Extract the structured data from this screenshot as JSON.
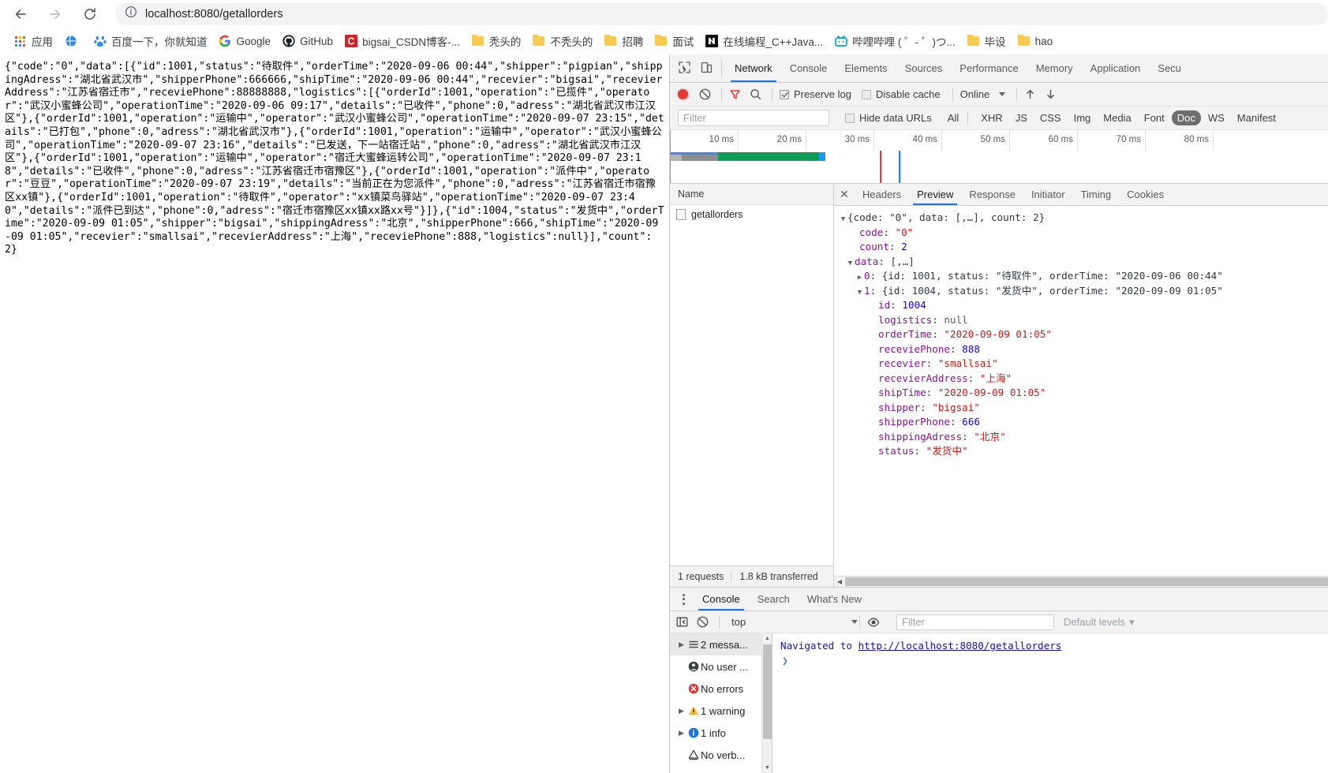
{
  "browser": {
    "back_icon": "back-arrow-icon",
    "forward_icon": "forward-arrow-icon",
    "reload_icon": "reload-icon",
    "site_info_icon": "site-info-icon",
    "url": "localhost:8080/getallorders",
    "url_host": "localhost:8080",
    "url_path": "/getallorders"
  },
  "bookmarks": [
    {
      "label": "应用",
      "icon": "apps-grid-icon"
    },
    {
      "label": "",
      "icon": "globe-icon"
    },
    {
      "label": "百度一下，你就知道",
      "icon": "baidu-icon"
    },
    {
      "label": "Google",
      "icon": "google-icon"
    },
    {
      "label": "GitHub",
      "icon": "github-icon"
    },
    {
      "label": "bigsai_CSDN博客-...",
      "icon": "csdn-icon"
    },
    {
      "label": "秃头的",
      "icon": "folder-icon"
    },
    {
      "label": "不秃头的",
      "icon": "folder-icon"
    },
    {
      "label": "招聘",
      "icon": "folder-icon"
    },
    {
      "label": "面试",
      "icon": "folder-icon"
    },
    {
      "label": "在线编程_C++Java...",
      "icon": "nowcoder-icon"
    },
    {
      "label": "哔哩哔哩 ( ゜- ゜)つ...",
      "icon": "bilibili-icon"
    },
    {
      "label": "毕设",
      "icon": "folder-icon"
    },
    {
      "label": "hao",
      "icon": "folder-icon"
    }
  ],
  "page": {
    "json_text": "{\"code\":\"0\",\"data\":[{\"id\":1001,\"status\":\"待取件\",\"orderTime\":\"2020-09-06 00:44\",\"shipper\":\"pigpian\",\"shippingAdress\":\"湖北省武汉市\",\"shipperPhone\":666666,\"shipTime\":\"2020-09-06 00:44\",\"recevier\":\"bigsai\",\"recevierAddress\":\"江苏省宿迁市\",\"receviePhone\":88888888,\"logistics\":[{\"orderId\":1001,\"operation\":\"已揽件\",\"operator\":\"武汉小蜜蜂公司\",\"operationTime\":\"2020-09-06 09:17\",\"details\":\"已收件\",\"phone\":0,\"adress\":\"湖北省武汉市江汉区\"},{\"orderId\":1001,\"operation\":\"运输中\",\"operator\":\"武汉小蜜蜂公司\",\"operationTime\":\"2020-09-07 23:15\",\"details\":\"已打包\",\"phone\":0,\"adress\":\"湖北省武汉市\"},{\"orderId\":1001,\"operation\":\"运输中\",\"operator\":\"武汉小蜜蜂公司\",\"operationTime\":\"2020-09-07 23:16\",\"details\":\"已发送，下一站宿迁站\",\"phone\":0,\"adress\":\"湖北省武汉市江汉区\"},{\"orderId\":1001,\"operation\":\"运输中\",\"operator\":\"宿迁大蜜蜂运转公司\",\"operationTime\":\"2020-09-07 23:18\",\"details\":\"已收件\",\"phone\":0,\"adress\":\"江苏省宿迁市宿豫区\"},{\"orderId\":1001,\"operation\":\"派件中\",\"operator\":\"豆豆\",\"operationTime\":\"2020-09-07 23:19\",\"details\":\"当前正在为您派件\",\"phone\":0,\"adress\":\"江苏省宿迁市宿豫区xx镇\"},{\"orderId\":1001,\"operation\":\"待取件\",\"operator\":\"xx镇菜鸟驿站\",\"operationTime\":\"2020-09-07 23:40\",\"details\":\"派件已到达\",\"phone\":0,\"adress\":\"宿迁市宿豫区xx镇xx路xx号\"}]},{\"id\":1004,\"status\":\"发货中\",\"orderTime\":\"2020-09-09 01:05\",\"shipper\":\"bigsai\",\"shippingAdress\":\"北京\",\"shipperPhone\":666,\"shipTime\":\"2020-09-09 01:05\",\"recevier\":\"smallsai\",\"recevierAddress\":\"上海\",\"receviePhone\":888,\"logistics\":null}],\"count\":2}"
  },
  "devtools": {
    "inspect_icon": "inspect-element-icon",
    "device_toolbar_icon": "device-toolbar-icon",
    "tabs": [
      {
        "label": "Network",
        "active": true
      },
      {
        "label": "Console",
        "active": false
      },
      {
        "label": "Elements",
        "active": false
      },
      {
        "label": "Sources",
        "active": false
      },
      {
        "label": "Performance",
        "active": false
      },
      {
        "label": "Memory",
        "active": false
      },
      {
        "label": "Application",
        "active": false
      },
      {
        "label": "Secu",
        "active": false
      }
    ],
    "network_toolbar": {
      "record_icon": "record-button-icon",
      "clear_icon": "clear-network-log-icon",
      "filter_icon": "filter-funnel-icon",
      "search_icon": "search-icon",
      "preserve_log_label": "Preserve log",
      "preserve_log_checked": true,
      "disable_cache_label": "Disable cache",
      "disable_cache_checked": false,
      "throttling_value": "Online",
      "throttling_caret": "chevron-down-icon",
      "import_har_icon": "import-har-icon",
      "export_har_icon": "export-har-icon"
    },
    "filter_bar": {
      "filter_placeholder": "Filter",
      "hide_data_urls_label": "Hide data URLs",
      "hide_data_urls_checked": false,
      "types": [
        {
          "label": "All",
          "selected": false
        },
        {
          "label": "XHR",
          "selected": false
        },
        {
          "label": "JS",
          "selected": false
        },
        {
          "label": "CSS",
          "selected": false
        },
        {
          "label": "Img",
          "selected": false
        },
        {
          "label": "Media",
          "selected": false
        },
        {
          "label": "Font",
          "selected": false
        },
        {
          "label": "Doc",
          "selected": true
        },
        {
          "label": "WS",
          "selected": false
        },
        {
          "label": "Manifest",
          "selected": false
        }
      ]
    },
    "overview": {
      "ticks": [
        "10 ms",
        "20 ms",
        "30 ms",
        "40 ms",
        "50 ms",
        "60 ms",
        "70 ms",
        "80 ms"
      ],
      "colors": {
        "queueing": "#b4b4b4",
        "stalled": "#8d8d8d",
        "request_sent": "#4285f4",
        "content_download": "#0f9d58",
        "finish": "#1a9cff",
        "dom_content_loaded": "#0b7dff",
        "load_event": "#e53935"
      }
    },
    "request_list": {
      "column_header": "Name",
      "rows": [
        {
          "name": "getallorders",
          "icon": "document-icon",
          "selected": true
        }
      ],
      "footer": {
        "requests": "1 requests",
        "transferred": "1.8 kB transferred"
      }
    },
    "detail": {
      "close_icon": "close-icon",
      "tabs": [
        {
          "label": "Headers",
          "active": false
        },
        {
          "label": "Preview",
          "active": true
        },
        {
          "label": "Response",
          "active": false
        },
        {
          "label": "Initiator",
          "active": false
        },
        {
          "label": "Timing",
          "active": false
        },
        {
          "label": "Cookies",
          "active": false
        }
      ],
      "preview_tree": [
        {
          "indent": 0,
          "tri": "▼",
          "segments": [
            {
              "t": "{code: ",
              "c": "plain"
            },
            {
              "t": "\"0\"",
              "c": "plain"
            },
            {
              "t": ", data: [,…], count: 2}",
              "c": "plain"
            }
          ]
        },
        {
          "indent": 1,
          "tri": "",
          "segments": [
            {
              "t": "code",
              "c": "name"
            },
            {
              "t": ": ",
              "c": "plain"
            },
            {
              "t": "\"0\"",
              "c": "str"
            }
          ]
        },
        {
          "indent": 1,
          "tri": "",
          "segments": [
            {
              "t": "count",
              "c": "name"
            },
            {
              "t": ": ",
              "c": "plain"
            },
            {
              "t": "2",
              "c": "num"
            }
          ]
        },
        {
          "indent": 0.6,
          "tri": "▼",
          "segments": [
            {
              "t": "data",
              "c": "name"
            },
            {
              "t": ": [,…]",
              "c": "plain"
            }
          ]
        },
        {
          "indent": 1.4,
          "tri": "▶",
          "segments": [
            {
              "t": "0",
              "c": "name"
            },
            {
              "t": ": {id: 1001, status: ",
              "c": "plain"
            },
            {
              "t": "\"待取件\"",
              "c": "plain"
            },
            {
              "t": ", orderTime: ",
              "c": "plain"
            },
            {
              "t": "\"2020-09-06 00:44\"",
              "c": "plain"
            }
          ]
        },
        {
          "indent": 1.4,
          "tri": "▼",
          "segments": [
            {
              "t": "1",
              "c": "name"
            },
            {
              "t": ": {id: 1004, status: ",
              "c": "plain"
            },
            {
              "t": "\"发货中\"",
              "c": "plain"
            },
            {
              "t": ", orderTime: ",
              "c": "plain"
            },
            {
              "t": "\"2020-09-09 01:05\"",
              "c": "plain"
            }
          ]
        },
        {
          "indent": 2.6,
          "tri": "",
          "segments": [
            {
              "t": "id",
              "c": "name"
            },
            {
              "t": ": ",
              "c": "plain"
            },
            {
              "t": "1004",
              "c": "num"
            }
          ]
        },
        {
          "indent": 2.6,
          "tri": "",
          "segments": [
            {
              "t": "logistics",
              "c": "name"
            },
            {
              "t": ": ",
              "c": "plain"
            },
            {
              "t": "null",
              "c": "null"
            }
          ]
        },
        {
          "indent": 2.6,
          "tri": "",
          "segments": [
            {
              "t": "orderTime",
              "c": "name"
            },
            {
              "t": ": ",
              "c": "plain"
            },
            {
              "t": "\"2020-09-09 01:05\"",
              "c": "str"
            }
          ]
        },
        {
          "indent": 2.6,
          "tri": "",
          "segments": [
            {
              "t": "receviePhone",
              "c": "name"
            },
            {
              "t": ": ",
              "c": "plain"
            },
            {
              "t": "888",
              "c": "num"
            }
          ]
        },
        {
          "indent": 2.6,
          "tri": "",
          "segments": [
            {
              "t": "recevier",
              "c": "name"
            },
            {
              "t": ": ",
              "c": "plain"
            },
            {
              "t": "\"smallsai\"",
              "c": "str"
            }
          ]
        },
        {
          "indent": 2.6,
          "tri": "",
          "segments": [
            {
              "t": "recevierAddress",
              "c": "name"
            },
            {
              "t": ": ",
              "c": "plain"
            },
            {
              "t": "\"上海\"",
              "c": "str"
            }
          ]
        },
        {
          "indent": 2.6,
          "tri": "",
          "segments": [
            {
              "t": "shipTime",
              "c": "name"
            },
            {
              "t": ": ",
              "c": "plain"
            },
            {
              "t": "\"2020-09-09 01:05\"",
              "c": "str"
            }
          ]
        },
        {
          "indent": 2.6,
          "tri": "",
          "segments": [
            {
              "t": "shipper",
              "c": "name"
            },
            {
              "t": ": ",
              "c": "plain"
            },
            {
              "t": "\"bigsai\"",
              "c": "str"
            }
          ]
        },
        {
          "indent": 2.6,
          "tri": "",
          "segments": [
            {
              "t": "shipperPhone",
              "c": "name"
            },
            {
              "t": ": ",
              "c": "plain"
            },
            {
              "t": "666",
              "c": "num"
            }
          ]
        },
        {
          "indent": 2.6,
          "tri": "",
          "segments": [
            {
              "t": "shippingAdress",
              "c": "name"
            },
            {
              "t": ": ",
              "c": "plain"
            },
            {
              "t": "\"北京\"",
              "c": "str"
            }
          ]
        },
        {
          "indent": 2.6,
          "tri": "",
          "segments": [
            {
              "t": "status",
              "c": "name"
            },
            {
              "t": ": ",
              "c": "plain"
            },
            {
              "t": "\"发货中\"",
              "c": "str"
            }
          ]
        }
      ]
    },
    "drawer": {
      "kebab_icon": "more-options-icon",
      "tabs": [
        {
          "label": "Console",
          "active": true
        },
        {
          "label": "Search",
          "active": false
        },
        {
          "label": "What's New",
          "active": false
        }
      ],
      "toolbar": {
        "sidebar_toggle_icon": "console-sidebar-toggle-icon",
        "clear_icon": "clear-console-icon",
        "context_value": "top",
        "context_caret": "chevron-down-icon",
        "eye_icon": "live-expression-icon",
        "filter_placeholder": "Filter",
        "levels_label": "Default levels",
        "levels_caret": "chevron-down-icon"
      },
      "sidebar": [
        {
          "label": "2 messa...",
          "icon": "list-icon",
          "tri": "▶",
          "selected": true
        },
        {
          "label": "No user ...",
          "icon": "user-message-icon",
          "tri": "",
          "selected": false
        },
        {
          "label": "No errors",
          "icon": "error-icon",
          "tri": "",
          "selected": false
        },
        {
          "label": "1 warning",
          "icon": "warning-icon",
          "tri": "▶",
          "selected": false
        },
        {
          "label": "1 info",
          "icon": "info-icon",
          "tri": "▶",
          "selected": false
        },
        {
          "label": "No verb...",
          "icon": "verbose-icon",
          "tri": "",
          "selected": false
        }
      ],
      "log": {
        "nav_prefix": "Navigated to ",
        "nav_url": "http://localhost:8080/getallorders",
        "prompt": "❯"
      }
    }
  }
}
